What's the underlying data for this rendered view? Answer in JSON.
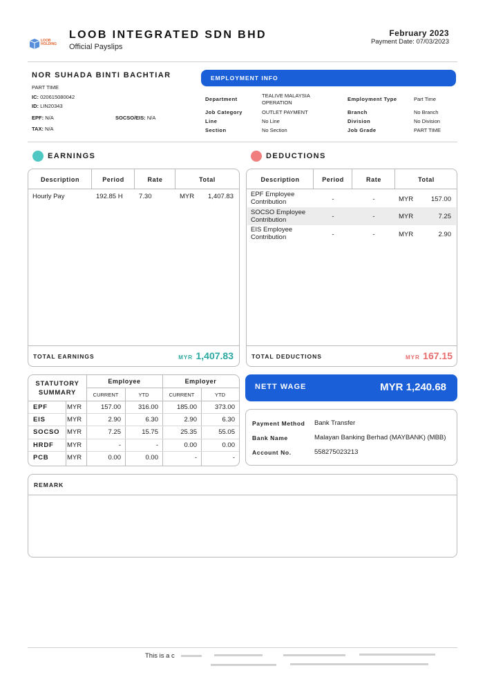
{
  "header": {
    "logo_text": "LOOB HOLDING",
    "company": "LOOB INTEGRATED SDN BHD",
    "subtitle": "Official Payslips",
    "month": "February 2023",
    "payment_date": "Payment Date: 07/03/2023"
  },
  "employee": {
    "name": "NOR SUHADA BINTI BACHTIAR",
    "type": "PART TIME",
    "ic_label": "IC:",
    "ic": "020615080042",
    "id_label": "ID:",
    "id": "LIN20343",
    "epf_label": "EPF:",
    "epf": "N/A",
    "socso_label": "SOCSO/EIS:",
    "socso": "N/A",
    "tax_label": "TAX:",
    "tax": "N/A"
  },
  "employment_info": {
    "title": "EMPLOYMENT INFO",
    "fields": [
      {
        "label": "Department",
        "value": "TEALIVE MALAYSIA OPERATION"
      },
      {
        "label": "Job Category",
        "value": "OUTLET PAYMENT"
      },
      {
        "label": "Line",
        "value": "No Line"
      },
      {
        "label": "Section",
        "value": "No Section"
      },
      {
        "label": "Employment Type",
        "value": "Part Time"
      },
      {
        "label": "Branch",
        "value": "No Branch"
      },
      {
        "label": "Division",
        "value": "No Division"
      },
      {
        "label": "Job Grade",
        "value": "PART TIME"
      }
    ]
  },
  "colors": {
    "accent_blue": "#1a5fd8",
    "earnings_teal": "#2aa8a0",
    "deductions_red": "#e86a6a"
  },
  "earnings": {
    "title": "EARNINGS",
    "columns": [
      "Description",
      "Period",
      "Rate",
      "Total"
    ],
    "rows": [
      {
        "description": "Hourly Pay",
        "period": "192.85 H",
        "rate": "7.30",
        "currency": "MYR",
        "total": "1,407.83"
      }
    ],
    "total_label": "TOTAL EARNINGS",
    "total_currency": "MYR",
    "total_value": "1,407.83"
  },
  "deductions": {
    "title": "DEDUCTIONS",
    "columns": [
      "Description",
      "Period",
      "Rate",
      "Total"
    ],
    "rows": [
      {
        "description": "EPF Employee Contribution",
        "period": "-",
        "rate": "-",
        "currency": "MYR",
        "total": "157.00"
      },
      {
        "description": "SOCSO Employee Contribution",
        "period": "-",
        "rate": "-",
        "currency": "MYR",
        "total": "7.25"
      },
      {
        "description": "EIS Employee Contribution",
        "period": "-",
        "rate": "-",
        "currency": "MYR",
        "total": "2.90"
      }
    ],
    "total_label": "TOTAL DEDUCTIONS",
    "total_currency": "MYR",
    "total_value": "167.15"
  },
  "statutory": {
    "title_line1": "STATUTORY",
    "title_line2": "SUMMARY",
    "employee_label": "Employee",
    "employer_label": "Employer",
    "current_label": "CURRENT",
    "ytd_label": "YTD",
    "rows": [
      {
        "name": "EPF",
        "currency": "MYR",
        "emp_current": "157.00",
        "emp_ytd": "316.00",
        "er_current": "185.00",
        "er_ytd": "373.00"
      },
      {
        "name": "EIS",
        "currency": "MYR",
        "emp_current": "2.90",
        "emp_ytd": "6.30",
        "er_current": "2.90",
        "er_ytd": "6.30"
      },
      {
        "name": "SOCSO",
        "currency": "MYR",
        "emp_current": "7.25",
        "emp_ytd": "15.75",
        "er_current": "25.35",
        "er_ytd": "55.05"
      },
      {
        "name": "HRDF",
        "currency": "MYR",
        "emp_current": "-",
        "emp_ytd": "-",
        "er_current": "0.00",
        "er_ytd": "0.00"
      },
      {
        "name": "PCB",
        "currency": "MYR",
        "emp_current": "0.00",
        "emp_ytd": "0.00",
        "er_current": "-",
        "er_ytd": "-"
      }
    ]
  },
  "nett": {
    "label": "NETT WAGE",
    "value": "MYR 1,240.68"
  },
  "payment": {
    "method_label": "Payment Method",
    "method": "Bank Transfer",
    "bank_label": "Bank Name",
    "bank": "Malayan Banking Berhad (MAYBANK) (MBB)",
    "account_label": "Account No.",
    "account": "558275023213"
  },
  "remark": {
    "title": "REMARK"
  },
  "footer": {
    "text": "This is a c"
  }
}
